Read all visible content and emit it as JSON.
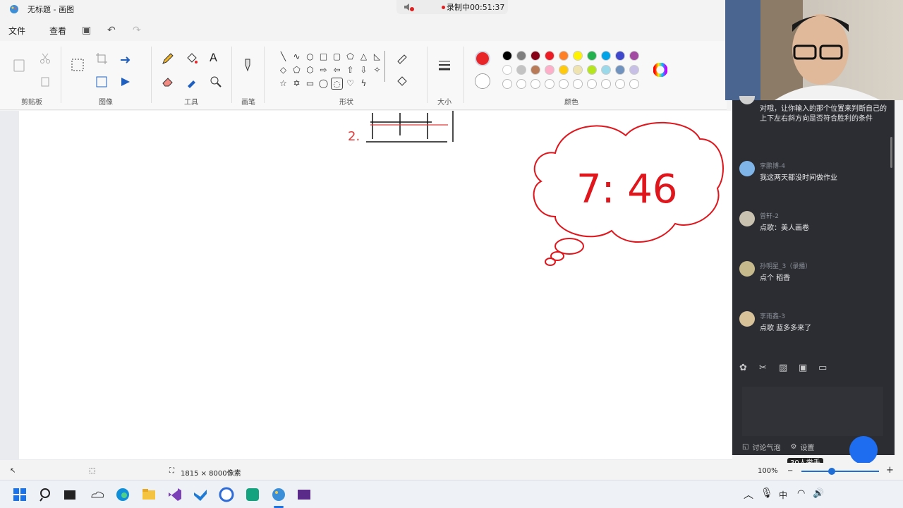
{
  "window": {
    "title": "无标题 - 画图"
  },
  "recording": {
    "label": "录制中00:51:37"
  },
  "menu": {
    "file": "文件",
    "view": "查看"
  },
  "ribbon": {
    "groups": {
      "clipboard": "剪贴板",
      "image": "图像",
      "tools": "工具",
      "brush": "画笔",
      "shapes": "形状",
      "size": "大小",
      "colors": "颜色"
    },
    "primary_color": "#e8262a",
    "secondary_color": "#ffffff",
    "palette_row1": [
      "#000000",
      "#7f7f7f",
      "#880015",
      "#ed1c24",
      "#ff7f27",
      "#fff200",
      "#22b14c",
      "#00a2e8",
      "#3f48cc",
      "#a349a4"
    ],
    "palette_row2": [
      "#ffffff",
      "#c3c3c3",
      "#b97a57",
      "#ffaec9",
      "#ffc90e",
      "#efe4b0",
      "#b5e61d",
      "#99d9ea",
      "#7092be",
      "#c8bfe7"
    ]
  },
  "drawing": {
    "cloud_text": "7: 46",
    "row_label": "2."
  },
  "chat": {
    "messages": [
      {
        "name": "",
        "text": "对哦，让你输入的那个位置来判断自己的上下左右斜方向是否符合胜利的条件"
      },
      {
        "name": "李鹏博-4",
        "text": "我这两天都没时间做作业"
      },
      {
        "name": "曾轩-2",
        "text": "点歌：美人画卷"
      },
      {
        "name": "孙明星_3（录播）",
        "text": "点个 稻香"
      },
      {
        "name": "李雨鑫-3",
        "text": "点歌     蓝多多来了"
      }
    ],
    "footer_bubble": "讨论气泡",
    "footer_settings": "设置",
    "raise_hand": "30人举手"
  },
  "status": {
    "dimensions": "1815 × 8000像素",
    "zoom": "100%"
  },
  "taskbar": {
    "ime": "中"
  }
}
